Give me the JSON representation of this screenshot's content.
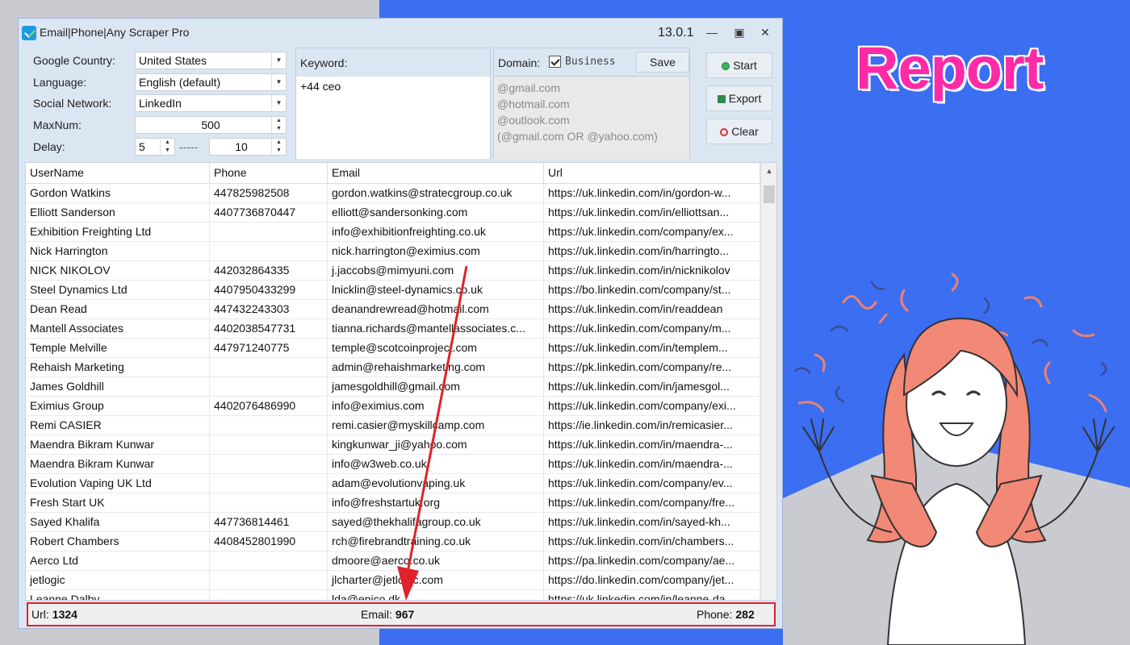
{
  "window": {
    "title": "Email|Phone|Any Scraper Pro",
    "version": "13.0.1"
  },
  "settings": {
    "google_country_label": "Google Country:",
    "google_country_value": "United States",
    "language_label": "Language:",
    "language_value": "English (default)",
    "social_network_label": "Social Network:",
    "social_network_value": "LinkedIn",
    "maxnum_label": "MaxNum:",
    "maxnum_value": "500",
    "delay_label": "Delay:",
    "delay_min": "5",
    "delay_sep": "-----",
    "delay_max": "10"
  },
  "keyword": {
    "label": "Keyword:",
    "value": "+44 ceo"
  },
  "domain": {
    "label": "Domain:",
    "business_label": "Business",
    "business_checked": true,
    "save_label": "Save",
    "lines": [
      "@gmail.com",
      "@hotmail.com",
      "@outlook.com",
      "(@gmail.com OR @yahoo.com)"
    ]
  },
  "actions": {
    "start_label": "Start",
    "export_label": "Export",
    "clear_label": "Clear"
  },
  "table": {
    "columns": [
      "UserName",
      "Phone",
      "Email",
      "Url"
    ],
    "rows": [
      [
        "Gordon Watkins",
        "447825982508",
        "gordon.watkins@stratecgroup.co.uk",
        "https://uk.linkedin.com/in/gordon-w..."
      ],
      [
        "Elliott Sanderson",
        "4407736870447",
        "elliott@sandersonking.com",
        "https://uk.linkedin.com/in/elliottsan..."
      ],
      [
        "Exhibition Freighting Ltd",
        "",
        "info@exhibitionfreighting.co.uk",
        "https://uk.linkedin.com/company/ex..."
      ],
      [
        "Nick Harrington",
        "",
        "nick.harrington@eximius.com",
        "https://uk.linkedin.com/in/harringto..."
      ],
      [
        "NICK NIKOLOV",
        "442032864335",
        "j.jaccobs@mimyuni.com",
        "https://uk.linkedin.com/in/nicknikolov"
      ],
      [
        "Steel Dynamics Ltd",
        "4407950433299",
        "lnicklin@steel-dynamics.co.uk",
        "https://bo.linkedin.com/company/st..."
      ],
      [
        "Dean Read",
        "447432243303",
        "deanandrewread@hotmail.com",
        "https://uk.linkedin.com/in/readdean"
      ],
      [
        "Mantell Associates",
        "4402038547731",
        "tianna.richards@mantellassociates.c...",
        "https://uk.linkedin.com/company/m..."
      ],
      [
        "Temple Melville",
        "447971240775",
        "temple@scotcoinproject.com",
        "https://uk.linkedin.com/in/templem..."
      ],
      [
        "Rehaish Marketing",
        "",
        "admin@rehaishmarketing.com",
        "https://pk.linkedin.com/company/re..."
      ],
      [
        "James Goldhill",
        "",
        "jamesgoldhill@gmail.com",
        "https://uk.linkedin.com/in/jamesgol..."
      ],
      [
        "Eximius Group",
        "4402076486990",
        "info@eximius.com",
        "https://uk.linkedin.com/company/exi..."
      ],
      [
        "Remi CASIER",
        "",
        "remi.casier@myskillcamp.com",
        "https://ie.linkedin.com/in/remicasier..."
      ],
      [
        "Maendra Bikram Kunwar",
        "",
        "kingkunwar_ji@yahoo.com",
        "https://uk.linkedin.com/in/maendra-..."
      ],
      [
        "Maendra Bikram Kunwar",
        "",
        "info@w3web.co.uk",
        "https://uk.linkedin.com/in/maendra-..."
      ],
      [
        "Evolution Vaping UK Ltd",
        "",
        "adam@evolutionvaping.uk",
        "https://uk.linkedin.com/company/ev..."
      ],
      [
        "Fresh Start UK",
        "",
        "info@freshstartuk.org",
        "https://uk.linkedin.com/company/fre..."
      ],
      [
        "Sayed Khalifa",
        "447736814461",
        "sayed@thekhalifagroup.co.uk",
        "https://uk.linkedin.com/in/sayed-kh..."
      ],
      [
        "Robert Chambers",
        "4408452801990",
        "rch@firebrandtraining.co.uk",
        "https://uk.linkedin.com/in/chambers..."
      ],
      [
        "Aerco Ltd",
        "",
        "dmoore@aerco.co.uk",
        "https://pa.linkedin.com/company/ae..."
      ],
      [
        "jetlogic",
        "",
        "jlcharter@jetlogic.com",
        "https://do.linkedin.com/company/jet..."
      ],
      [
        "Leanne Dalby",
        "",
        "lda@epico.dk",
        "https://uk.linkedin.com/in/leanne-da..."
      ]
    ]
  },
  "status": {
    "url_label": "Url:",
    "url_count": "1324",
    "email_label": "Email:",
    "email_count": "967",
    "phone_label": "Phone:",
    "phone_count": "282"
  },
  "banner": {
    "title": "Report"
  },
  "colors": {
    "accent_red": "#e0222a",
    "report_pink": "#ff2aa6",
    "background_blue": "#3b6ef0"
  }
}
